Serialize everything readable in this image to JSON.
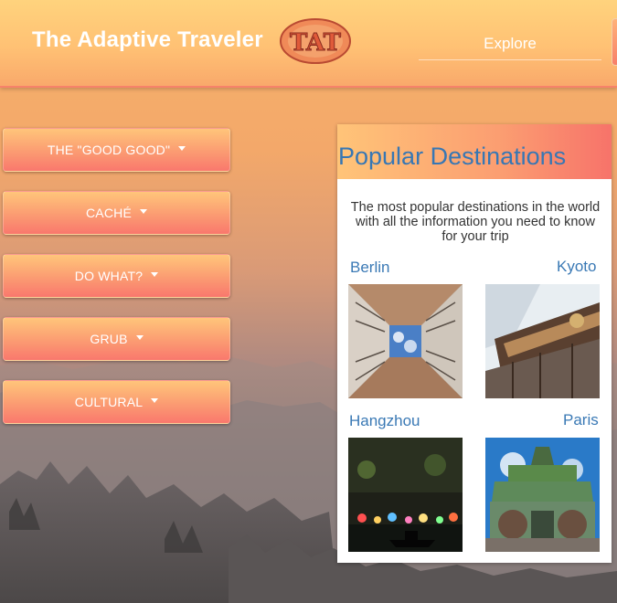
{
  "header": {
    "brand_title": "The Adaptive Traveler",
    "logo_letters": "TAT",
    "nav": {
      "explore_label": "Explore"
    }
  },
  "side_nav": {
    "items": [
      {
        "label": "THE \"GOOD GOOD\""
      },
      {
        "label": "CACHÉ"
      },
      {
        "label": "DO WHAT?"
      },
      {
        "label": "GRUB"
      },
      {
        "label": "CULTURAL"
      }
    ]
  },
  "card": {
    "title": "Popular Destinations",
    "description": "The most popular destinations in the world with all the information you need to know for your trip",
    "destinations": [
      {
        "name": "Berlin"
      },
      {
        "name": "Kyoto"
      },
      {
        "name": "Hangzhou"
      },
      {
        "name": "Paris"
      }
    ]
  },
  "colors": {
    "accent_blue": "#3777b4",
    "button_top": "#ffc57a",
    "button_bottom": "#f9786d",
    "header_bg": "#ffc174"
  }
}
